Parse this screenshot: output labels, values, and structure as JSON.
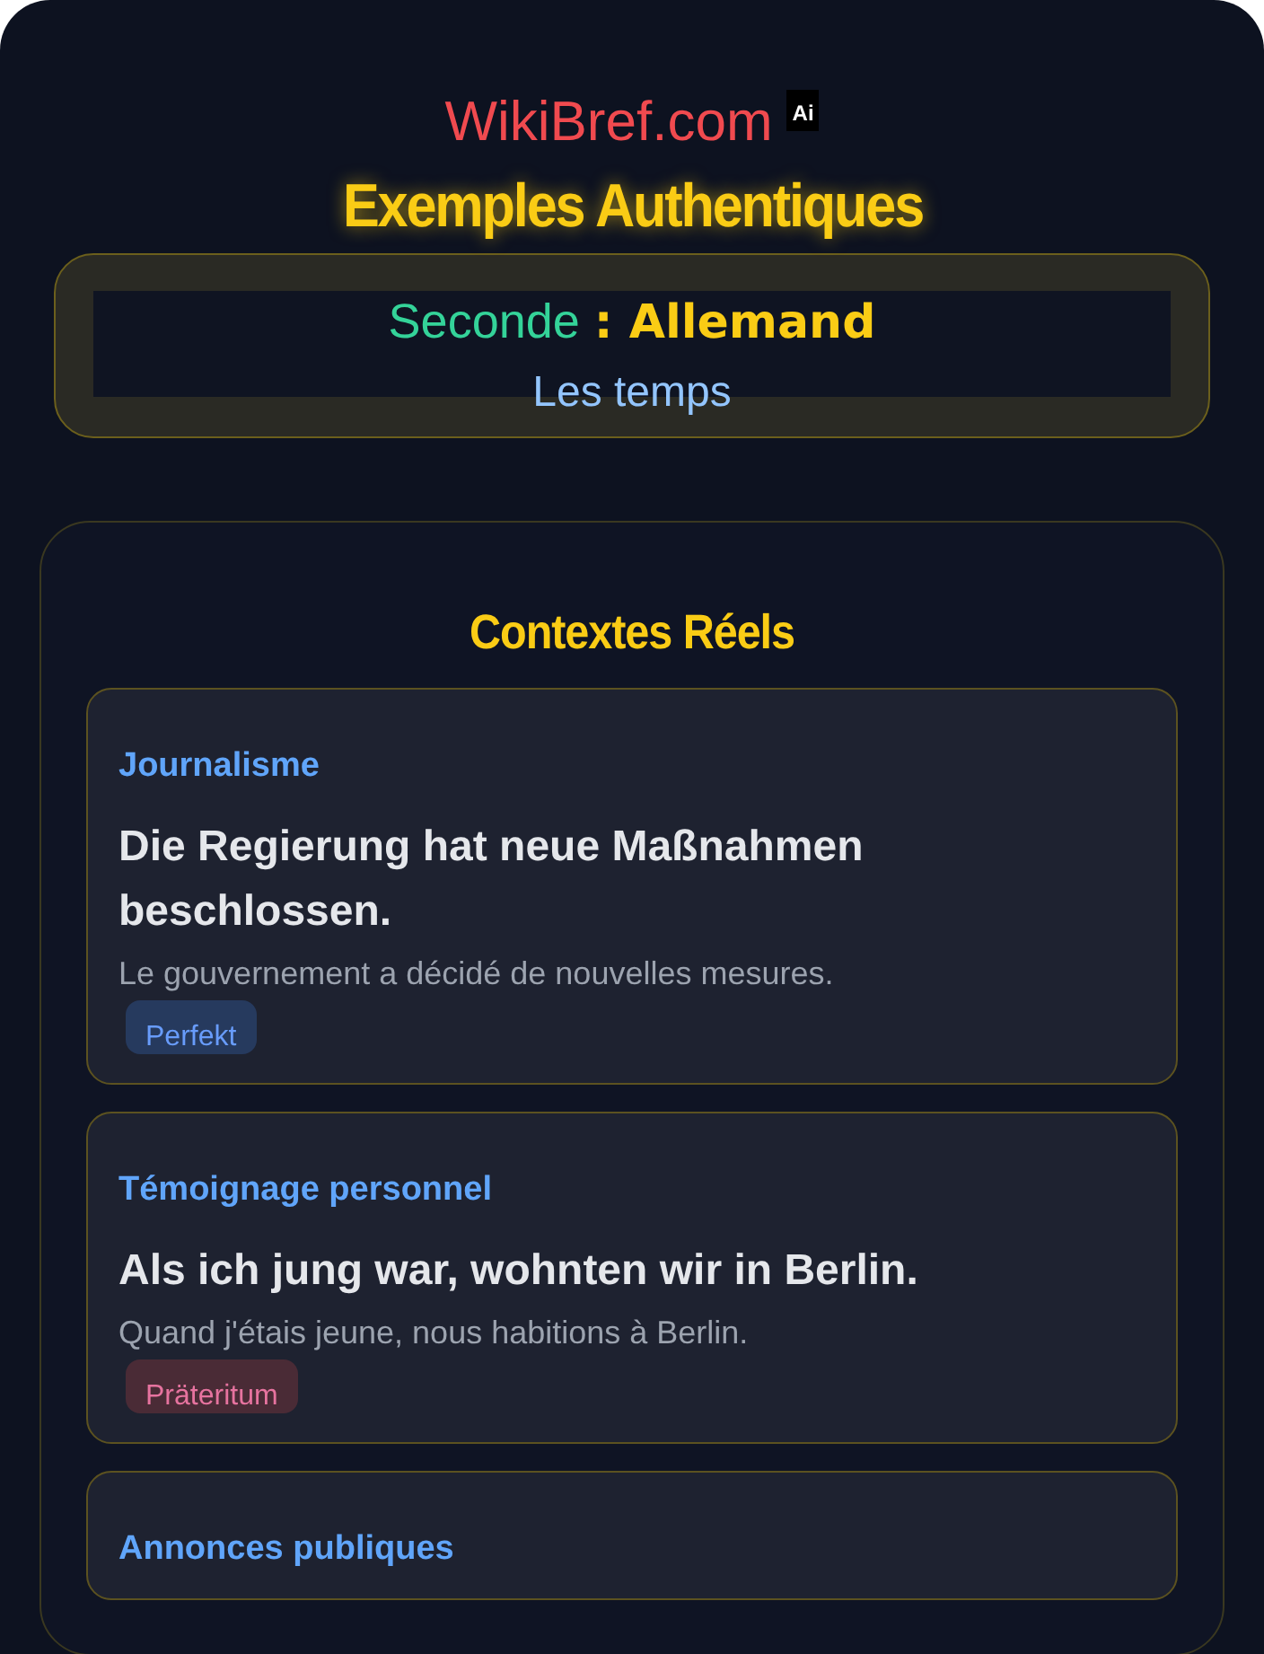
{
  "site": {
    "name": "WikiBref.com",
    "badge": "Ai"
  },
  "title": "Exemples Authentiques",
  "subject": {
    "level": "Seconde",
    "language": ": Allemand",
    "topic": "Les temps"
  },
  "section": {
    "heading": "Contextes Réels",
    "examples": [
      {
        "context": "Journalisme",
        "sentence": "Die Regierung hat neue Maßnahmen beschlossen.",
        "translation": "Le gouvernement a décidé de nouvelles mesures.",
        "tag": "Perfekt",
        "color": "#263a5e"
      },
      {
        "context": "Témoignage personnel",
        "sentence": "Als ich jung war, wohnten wir in Berlin.",
        "translation": "Quand j'étais jeune, nous habitions à Berlin.",
        "tag": "Präteritum",
        "color": "#4a2b36"
      },
      {
        "context": "Annonces publiques"
      }
    ]
  }
}
